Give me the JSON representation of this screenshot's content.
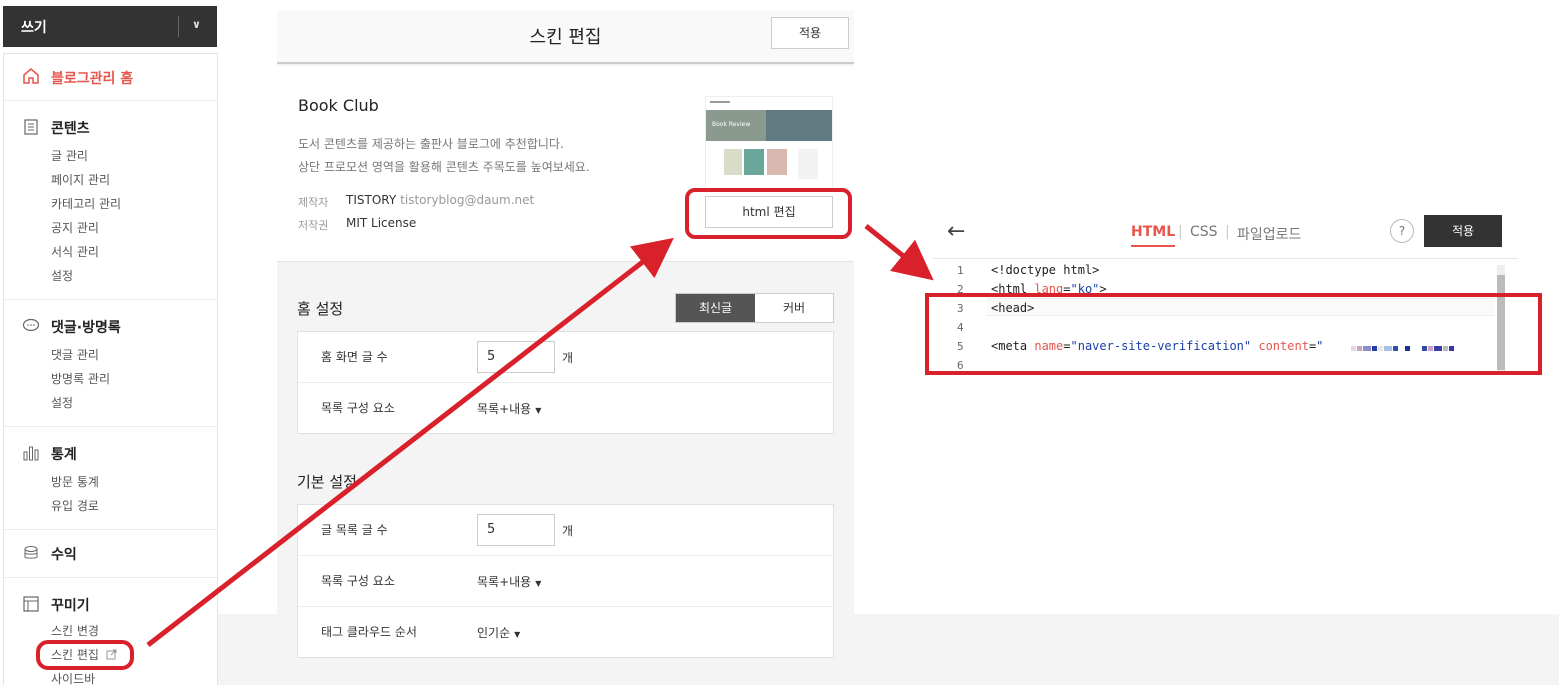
{
  "sidebar": {
    "write_label": "쓰기",
    "home_label": "블로그관리 홈",
    "groups": {
      "contents": {
        "title": "콘텐츠",
        "items": [
          "글 관리",
          "페이지 관리",
          "카테고리 관리",
          "공지 관리",
          "서식 관리",
          "설정"
        ]
      },
      "comments": {
        "title": "댓글·방명록",
        "items": [
          "댓글 관리",
          "방명록 관리",
          "설정"
        ]
      },
      "stats": {
        "title": "통계",
        "items": [
          "방문 통계",
          "유입 경로"
        ]
      },
      "revenue": {
        "title": "수익"
      },
      "decorate": {
        "title": "꾸미기",
        "items": [
          "스킨 변경",
          "스킨 편집",
          "사이드바"
        ]
      }
    }
  },
  "skin_editor": {
    "title": "스킨 편집",
    "apply_label": "적용",
    "skin_name": "Book Club",
    "desc_line1": "도서 콘텐츠를 제공하는 출판사 블로그에 추천합니다.",
    "desc_line2": "상단 프로모션 영역을 활용해 콘텐츠 주목도를 높여보세요.",
    "maker_label": "제작자",
    "maker_value": "TISTORY",
    "maker_email": "tistoryblog@daum.net",
    "license_label": "저작권",
    "license_value": "MIT License",
    "html_edit_label": "html 편집",
    "thumb_caption": "Book Review"
  },
  "home_settings": {
    "title": "홈 설정",
    "tabs": [
      "최신글",
      "커버"
    ],
    "rows": [
      {
        "label": "홈 화면 글 수",
        "value": "5",
        "unit": "개"
      },
      {
        "label": "목록 구성 요소",
        "value": "목록+내용"
      }
    ]
  },
  "basic_settings": {
    "title": "기본 설정",
    "rows": [
      {
        "label": "글 목록 글 수",
        "value": "5",
        "unit": "개"
      },
      {
        "label": "목록 구성 요소",
        "value": "목록+내용"
      },
      {
        "label": "태그 클라우드 순서",
        "value": "인기순"
      }
    ]
  },
  "code_editor": {
    "tabs": [
      "HTML",
      "CSS",
      "파일업로드"
    ],
    "active_tab": "HTML",
    "help_label": "?",
    "apply_label": "적용",
    "lines": [
      {
        "num": "1",
        "text": "<!doctype html>"
      },
      {
        "num": "2",
        "tag_open": "<html ",
        "attr": "lang",
        "eq": "=",
        "str": "\"ko\"",
        "tag_close": ">"
      },
      {
        "num": "3",
        "text": "<head>"
      },
      {
        "num": "4",
        "text": ""
      },
      {
        "num": "5",
        "tag_open": "<meta ",
        "attr1": "name",
        "str1": "\"naver-site-verification\"",
        "attr2": "content",
        "str2": "\""
      },
      {
        "num": "6",
        "text": ""
      }
    ]
  },
  "colors": {
    "accent": "#e8554c",
    "annotation": "#d9212b",
    "dark": "#333333"
  }
}
